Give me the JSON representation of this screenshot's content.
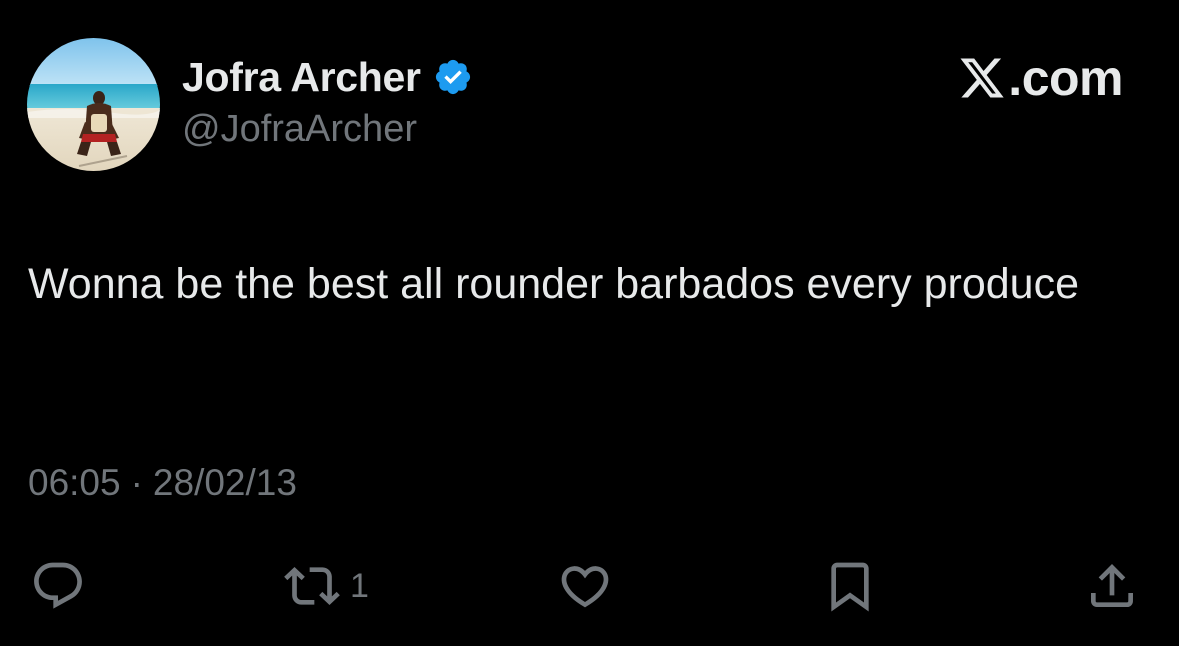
{
  "author": {
    "display_name": "Jofra Archer",
    "handle": "@JofraArcher",
    "verified": true
  },
  "brand": {
    "text": ".com"
  },
  "tweet": {
    "text": "Wonna be the best all rounder barbados every produce",
    "time": "06:05",
    "separator": "·",
    "date": "28/02/13"
  },
  "actions": {
    "retweet_count": "1"
  },
  "icons": {
    "avatar": "beach-photo-avatar",
    "verified": "verified-badge-icon",
    "brand": "x-logo-icon",
    "reply": "reply-icon",
    "retweet": "retweet-icon",
    "like": "heart-icon",
    "bookmark": "bookmark-icon",
    "share": "share-icon"
  },
  "colors": {
    "background": "#000000",
    "text_primary": "#e7e9ea",
    "text_secondary": "#71767b",
    "verified_blue": "#1d9bf0"
  }
}
